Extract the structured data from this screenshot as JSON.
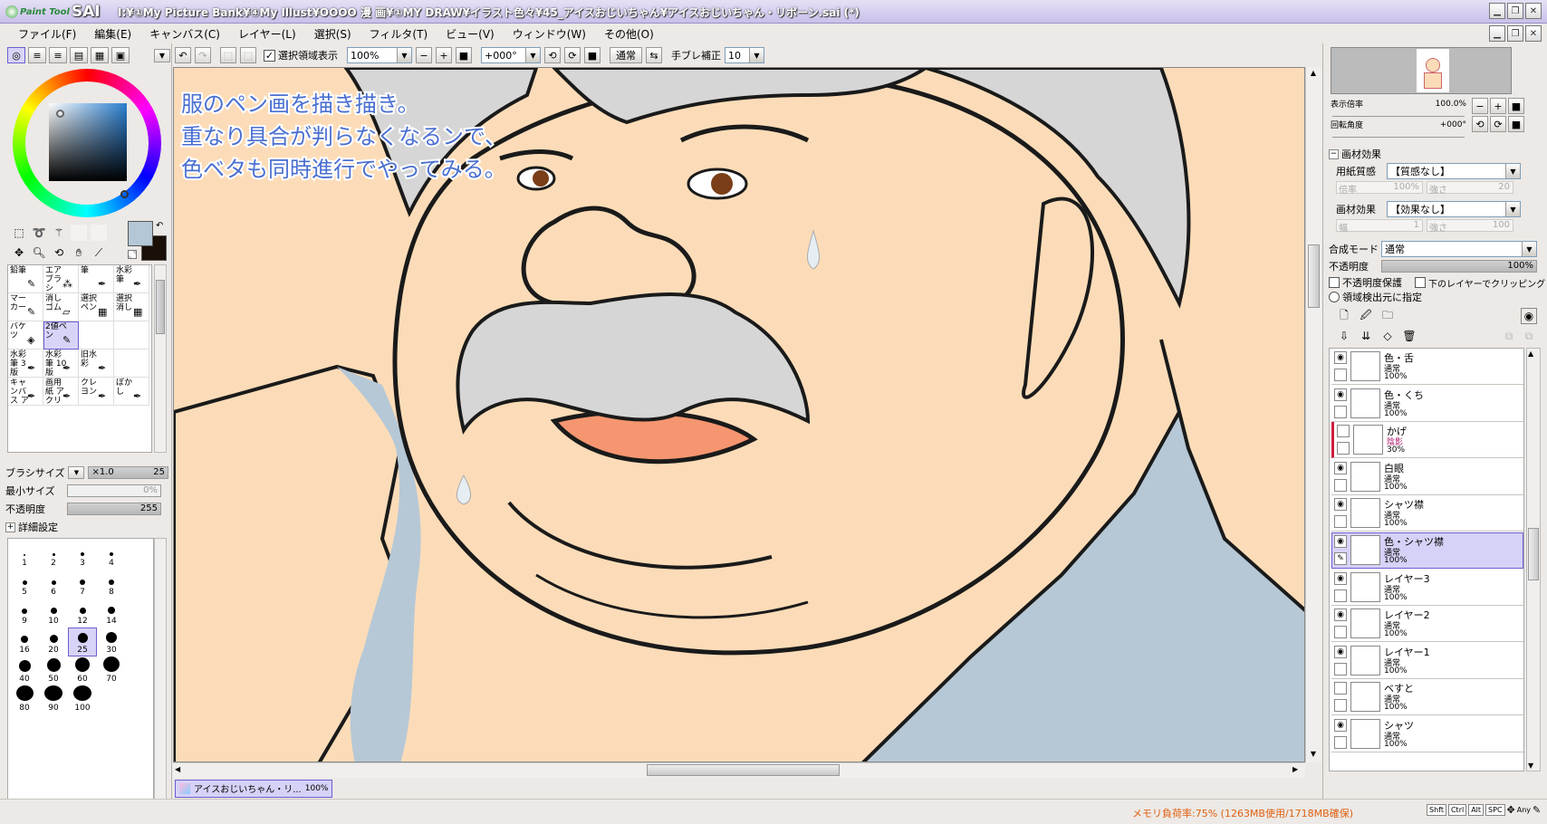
{
  "titlebar": {
    "logo_small": "Paint Tool",
    "logo_big": "SAI",
    "title": "I:¥①My Picture Bank¥④My Illust¥OOOO 漫 画¥①MY DRAW¥イラスト色々¥45_アイスおじいちゃん¥アイスおじいちゃん・リボーン.sai (*)"
  },
  "menu": [
    "ファイル(F)",
    "編集(E)",
    "キャンバス(C)",
    "レイヤー(L)",
    "選択(S)",
    "フィルタ(T)",
    "ビュー(V)",
    "ウィンドウ(W)",
    "その他(O)"
  ],
  "toolbar": {
    "show_selection_label": "選択領域表示",
    "zoom": "100%",
    "rotation": "+000°",
    "blend_mode": "通常",
    "stabilizer_label": "手ブレ補正",
    "stabilizer_value": "10"
  },
  "canvas": {
    "caption_lines": [
      "服のペン画を描き描き。",
      "重なり具合が判らなくなるンで、",
      "色ベタも同時進行でやってみる。"
    ]
  },
  "colors": {
    "primary": "#b3c7d6",
    "secondary": "#1a1008",
    "skin": "#fcdcb8",
    "shirt": "#b6c8d6",
    "hair": "#d6d6d6",
    "caption": "#4a6fd0",
    "accent": "#6a5fd0"
  },
  "tools": [
    {
      "label": "鉛筆",
      "icon": "pencil-icon",
      "glyph": "✎"
    },
    {
      "label": "エアブラシ",
      "icon": "airbrush-icon",
      "glyph": "⁂"
    },
    {
      "label": "筆",
      "icon": "brush-icon",
      "glyph": "✒"
    },
    {
      "label": "水彩筆",
      "icon": "watercolor-icon",
      "glyph": "✒"
    },
    {
      "label": "マーカー",
      "icon": "marker-icon",
      "glyph": "✎"
    },
    {
      "label": "消しゴム",
      "icon": "eraser-icon",
      "glyph": "▱"
    },
    {
      "label": "選択ペン",
      "icon": "select-pen-icon",
      "glyph": "▦"
    },
    {
      "label": "選択消し",
      "icon": "select-erase-icon",
      "glyph": "▦"
    },
    {
      "label": "バケツ",
      "icon": "bucket-icon",
      "glyph": "◈"
    },
    {
      "label": "2値ペン",
      "icon": "binary-pen-icon",
      "glyph": "✎"
    },
    {
      "label": "",
      "icon": "",
      "glyph": ""
    },
    {
      "label": "",
      "icon": "",
      "glyph": ""
    },
    {
      "label": "水彩筆 3版",
      "icon": "watercolor3-icon",
      "glyph": "✒"
    },
    {
      "label": "水彩筆 10版",
      "icon": "watercolor10-icon",
      "glyph": "✒"
    },
    {
      "label": "旧水彩",
      "icon": "old-watercolor-icon",
      "glyph": "✒"
    },
    {
      "label": "",
      "icon": "",
      "glyph": ""
    },
    {
      "label": "キャンバス アクリル",
      "icon": "canvas-acrylic-icon",
      "glyph": "✒"
    },
    {
      "label": "画用紙 アクリル",
      "icon": "paper-acrylic-icon",
      "glyph": "✒"
    },
    {
      "label": "クレヨン",
      "icon": "crayon-icon",
      "glyph": "✒"
    },
    {
      "label": "ぼかし",
      "icon": "blur-icon",
      "glyph": "✒"
    }
  ],
  "brush": {
    "size_label": "ブラシサイズ",
    "size_mult": "×1.0",
    "size_value": "25",
    "min_size_label": "最小サイズ",
    "min_size_value": "0%",
    "density_label": "不透明度",
    "density_value": "255",
    "advanced_label": "詳細設定",
    "density_fraction": 1.0
  },
  "brush_sizes": [
    "1",
    "2",
    "3",
    "4",
    "5",
    "6",
    "7",
    "8",
    "9",
    "10",
    "12",
    "14",
    "16",
    "20",
    "25",
    "30",
    "40",
    "50",
    "60",
    "70",
    "80",
    "90",
    "100"
  ],
  "selected_brush_size": "25",
  "navigator": {
    "zoom_label": "表示倍率",
    "zoom_value": "100.0%",
    "angle_label": "回転角度",
    "angle_value": "+000°"
  },
  "material": {
    "section_label": "画材効果",
    "paper_label": "用紙質感",
    "paper_value": "【質感なし】",
    "scale_label": "倍率",
    "scale_value": "100%",
    "strength_label": "強さ",
    "strength_value": "20",
    "effect_label": "画材効果",
    "effect_value": "【効果なし】",
    "width_label": "幅",
    "width_value": "1",
    "effect_strength_label": "強さ",
    "effect_strength_value": "100"
  },
  "layer_props": {
    "mode_label": "合成モード",
    "mode_value": "通常",
    "opacity_label": "不透明度",
    "opacity_value": "100%",
    "opacity_fraction": 1.0,
    "preserve_label": "不透明度保護",
    "clip_label": "下のレイヤーでクリッピング",
    "source_label": "領域検出元に指定"
  },
  "layers": [
    {
      "name": "色・舌",
      "mode": "通常",
      "opacity": "100%",
      "visible": true,
      "selected": false,
      "mode_color": "#000000",
      "marker": false
    },
    {
      "name": "色・くち",
      "mode": "通常",
      "opacity": "100%",
      "visible": true,
      "selected": false,
      "mode_color": "#000000",
      "marker": false
    },
    {
      "name": "かげ",
      "mode": "陰影",
      "opacity": "30%",
      "visible": false,
      "selected": false,
      "mode_color": "#b02070",
      "marker": true
    },
    {
      "name": "白眼",
      "mode": "通常",
      "opacity": "100%",
      "visible": true,
      "selected": false,
      "mode_color": "#000000",
      "marker": false
    },
    {
      "name": "シャツ襟",
      "mode": "通常",
      "opacity": "100%",
      "visible": true,
      "selected": false,
      "mode_color": "#000000",
      "marker": false
    },
    {
      "name": "色・シャツ襟",
      "mode": "通常",
      "opacity": "100%",
      "visible": true,
      "selected": true,
      "mode_color": "#000000",
      "marker": false
    },
    {
      "name": "レイヤー3",
      "mode": "通常",
      "opacity": "100%",
      "visible": true,
      "selected": false,
      "mode_color": "#000000",
      "marker": false
    },
    {
      "name": "レイヤー2",
      "mode": "通常",
      "opacity": "100%",
      "visible": true,
      "selected": false,
      "mode_color": "#000000",
      "marker": false
    },
    {
      "name": "レイヤー1",
      "mode": "通常",
      "opacity": "100%",
      "visible": true,
      "selected": false,
      "mode_color": "#000000",
      "marker": false
    },
    {
      "name": "ベすと",
      "mode": "通常",
      "opacity": "100%",
      "visible": false,
      "selected": false,
      "mode_color": "#000000",
      "marker": false
    },
    {
      "name": "シャツ",
      "mode": "通常",
      "opacity": "100%",
      "visible": true,
      "selected": false,
      "mode_color": "#000000",
      "marker": false
    }
  ],
  "document_tab": {
    "name": "アイスおじいちゃん・リ...",
    "zoom": "100%"
  },
  "status": {
    "memory": "メモリ負荷率:75% (1263MB使用/1718MB確保)",
    "keys": [
      "Shft",
      "Ctrl",
      "Alt",
      "SPC"
    ],
    "any": "Any"
  }
}
